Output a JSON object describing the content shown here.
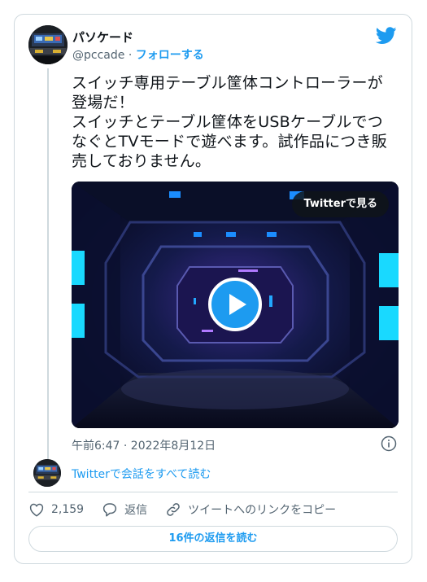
{
  "author": {
    "name": "パソケード",
    "handle": "@pccade",
    "separator": "·",
    "follow_label": "フォローする"
  },
  "tweet": {
    "text": "スイッチ専用テーブル筐体コントローラーが\n登場だ！\nスイッチとテーブル筐体をUSBケーブルでつ\nなぐとTVモードで遊べます。試作品につき販\n売しておりません。"
  },
  "media": {
    "watch_label": "Twitterで見る"
  },
  "meta": {
    "timestamp": "午前6:47 · 2022年8月12日"
  },
  "conversation": {
    "read_label": "Twitterで会話をすべて読む"
  },
  "actions": {
    "like_count": "2,159",
    "reply_label": "返信",
    "copy_link_label": "ツイートへのリンクをコピー"
  },
  "replies": {
    "button_label": "16件の返信を読む"
  },
  "colors": {
    "accent": "#1d9bf0",
    "text": "#0f1419",
    "muted": "#536471",
    "border": "#cfd9de"
  }
}
